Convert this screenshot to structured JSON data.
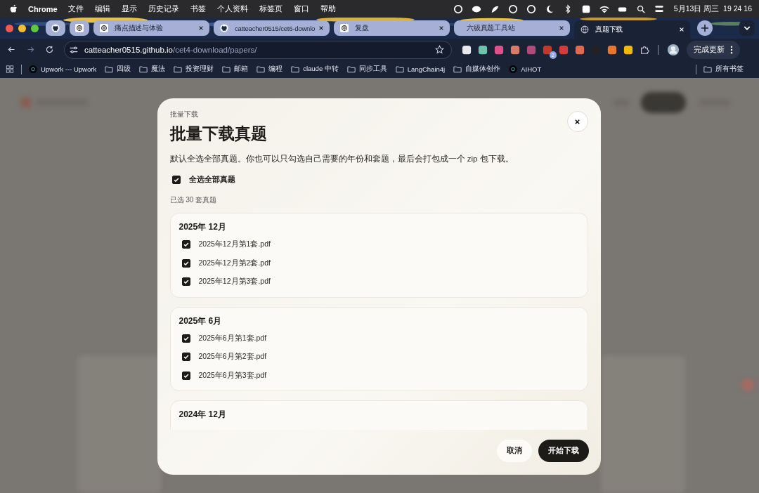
{
  "menu_bar": {
    "app": "Chrome",
    "menus": [
      "文件",
      "编辑",
      "显示",
      "历史记录",
      "书签",
      "个人资料",
      "标签页",
      "窗口",
      "帮助"
    ],
    "clock": "5月13日 周三  19 24 16"
  },
  "tabs": [
    {
      "kind": "github",
      "selected": false
    },
    {
      "kind": "openai",
      "selected": false
    },
    {
      "kind": "openai",
      "label": "痛点描述与体验",
      "selected": false
    },
    {
      "kind": "github",
      "label": "catteacher0515/cet6-downlo",
      "selected": false
    },
    {
      "kind": "openai",
      "label": "复盘",
      "selected": false
    },
    {
      "kind": "blank",
      "label": "六级真题工具站",
      "selected": false
    },
    {
      "kind": "globe",
      "label": "真题下载",
      "selected": true
    }
  ],
  "address": {
    "host": "catteacher0515.github.io",
    "path": "/cet4-download/papers/"
  },
  "extension_badge": "2",
  "update_button": "完成更新",
  "bookmarks": [
    {
      "kind": "site",
      "label": "Upwork --- Upwork"
    },
    {
      "kind": "folder",
      "label": "四级"
    },
    {
      "kind": "folder",
      "label": "魔法"
    },
    {
      "kind": "folder",
      "label": "投资理财"
    },
    {
      "kind": "folder",
      "label": "邮箱"
    },
    {
      "kind": "folder",
      "label": "编程"
    },
    {
      "kind": "folder",
      "label": "claude 中转"
    },
    {
      "kind": "folder",
      "label": "同步工具"
    },
    {
      "kind": "folder",
      "label": "LangChain4j"
    },
    {
      "kind": "folder",
      "label": "自媒体创作"
    },
    {
      "kind": "site",
      "label": "AIHOT"
    }
  ],
  "all_bookmarks": "所有书签",
  "dialog": {
    "eyebrow": "批量下载",
    "title": "批量下载真题",
    "description": "默认全选全部真题。你也可以只勾选自己需要的年份和套题，最后会打包成一个 zip 包下载。",
    "select_all": {
      "label": "全选全部真题",
      "checked": true
    },
    "count": "已选 30 套真题",
    "groups": [
      {
        "title": "2025年 12月",
        "files": [
          {
            "name": "2025年12月第1套.pdf",
            "checked": true
          },
          {
            "name": "2025年12月第2套.pdf",
            "checked": true
          },
          {
            "name": "2025年12月第3套.pdf",
            "checked": true
          }
        ]
      },
      {
        "title": "2025年 6月",
        "files": [
          {
            "name": "2025年6月第1套.pdf",
            "checked": true
          },
          {
            "name": "2025年6月第2套.pdf",
            "checked": true
          },
          {
            "name": "2025年6月第3套.pdf",
            "checked": true
          }
        ]
      },
      {
        "title": "2024年 12月"
      }
    ],
    "buttons": [
      {
        "kind": "secondary",
        "label": "取消"
      },
      {
        "kind": "primary",
        "label": "开始下载"
      }
    ]
  }
}
